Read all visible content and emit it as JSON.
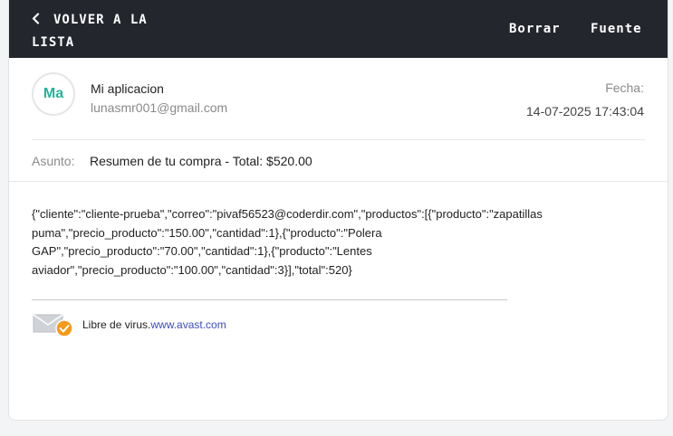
{
  "topbar": {
    "back_line1": "VOLVER A LA",
    "back_line2": "LISTA",
    "delete_label": "Borrar",
    "source_label": "Fuente",
    "background": "#24262d"
  },
  "sender": {
    "initials": "Ma",
    "name": "Mi aplicacion",
    "email": "lunasmr001@gmail.com",
    "avatar_color": "#22b39a"
  },
  "date": {
    "label": "Fecha:",
    "value": "14-07-2025 17:43:04"
  },
  "subject": {
    "label": "Asunto:",
    "value": "Resumen de tu compra - Total: $520.00"
  },
  "body": {
    "text": "{\"cliente\":\"cliente-prueba\",\"correo\":\"pivaf56523@coderdir.com\",\"productos\":[{\"producto\":\"zapatillas puma\",\"precio_producto\":\"150.00\",\"cantidad\":1},{\"producto\":\"Polera GAP\",\"precio_producto\":\"70.00\",\"cantidad\":1},{\"producto\":\"Lentes aviador\",\"precio_producto\":\"100.00\",\"cantidad\":3}],\"total\":520}"
  },
  "footer": {
    "virus_text": "Libre de virus.",
    "virus_link": "www.avast.com",
    "icon": "avast-mail-check-icon"
  }
}
